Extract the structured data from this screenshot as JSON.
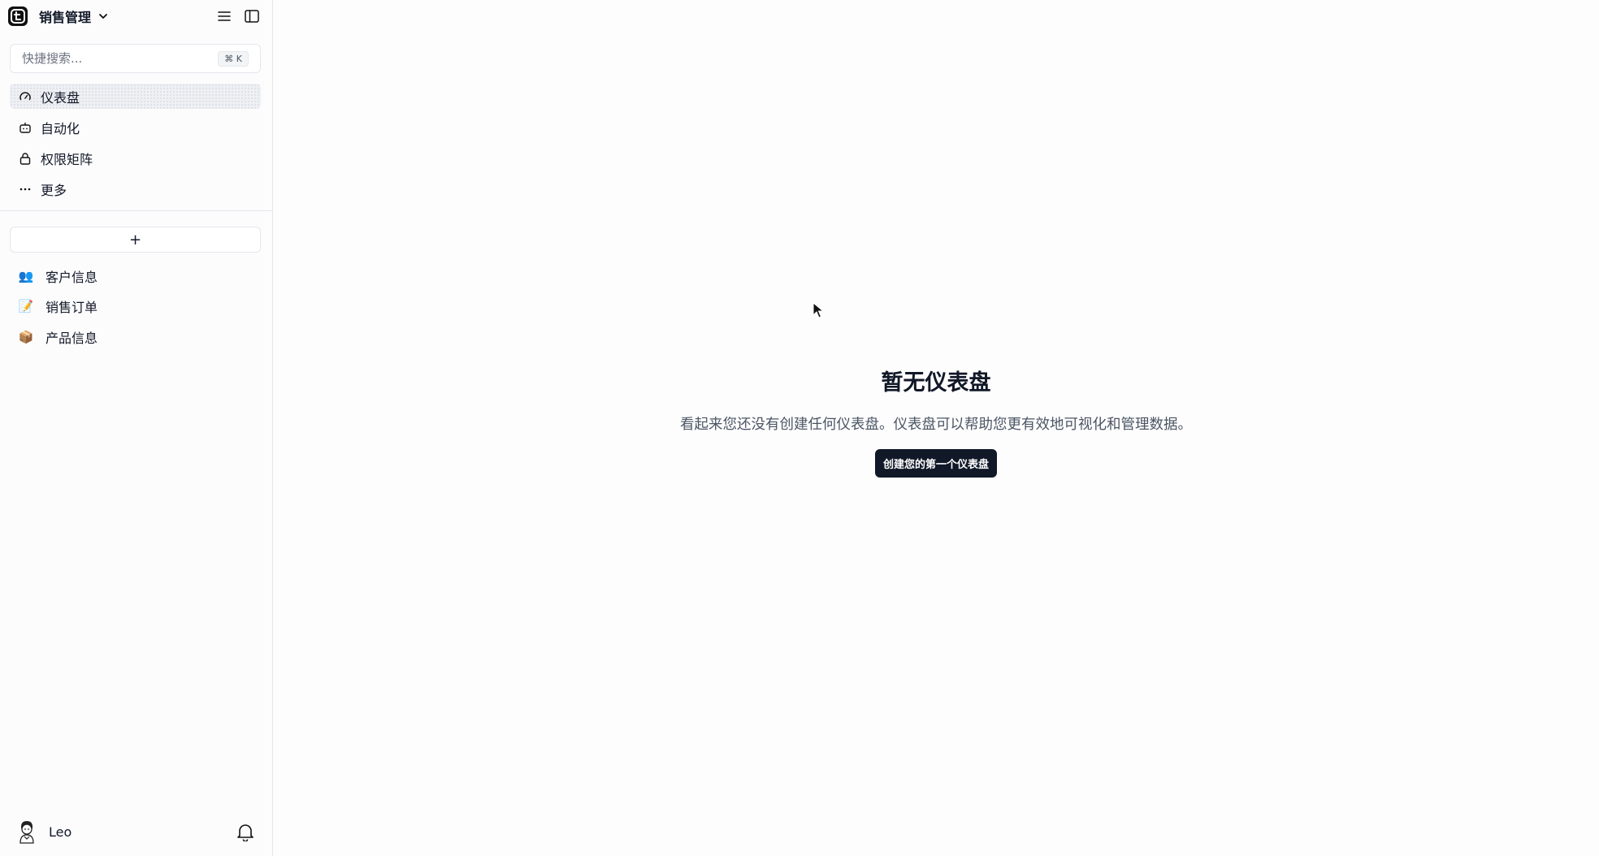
{
  "header": {
    "workspace_name": "销售管理"
  },
  "search": {
    "placeholder": "快捷搜索...",
    "shortcut": "⌘ K"
  },
  "nav": {
    "items": [
      {
        "label": "仪表盘",
        "icon": "gauge-icon",
        "active": true
      },
      {
        "label": "自动化",
        "icon": "robot-icon"
      },
      {
        "label": "权限矩阵",
        "icon": "lock-icon"
      },
      {
        "label": "更多",
        "icon": "more-dots-icon"
      }
    ]
  },
  "add_button_label": "+",
  "tables": [
    {
      "emoji": "👥",
      "label": "客户信息"
    },
    {
      "emoji": "📝",
      "label": "销售订单"
    },
    {
      "emoji": "📦",
      "label": "产品信息"
    }
  ],
  "user": {
    "name": "Leo"
  },
  "empty_state": {
    "title": "暂无仪表盘",
    "description": "看起来您还没有创建任何仪表盘。仪表盘可以帮助您更有效地可视化和管理数据。",
    "button_label": "创建您的第一个仪表盘"
  },
  "colors": {
    "primary_button": "#111827",
    "sidebar_bg": "#fcfcfd",
    "active_nav_bg": "#eef0f4"
  }
}
